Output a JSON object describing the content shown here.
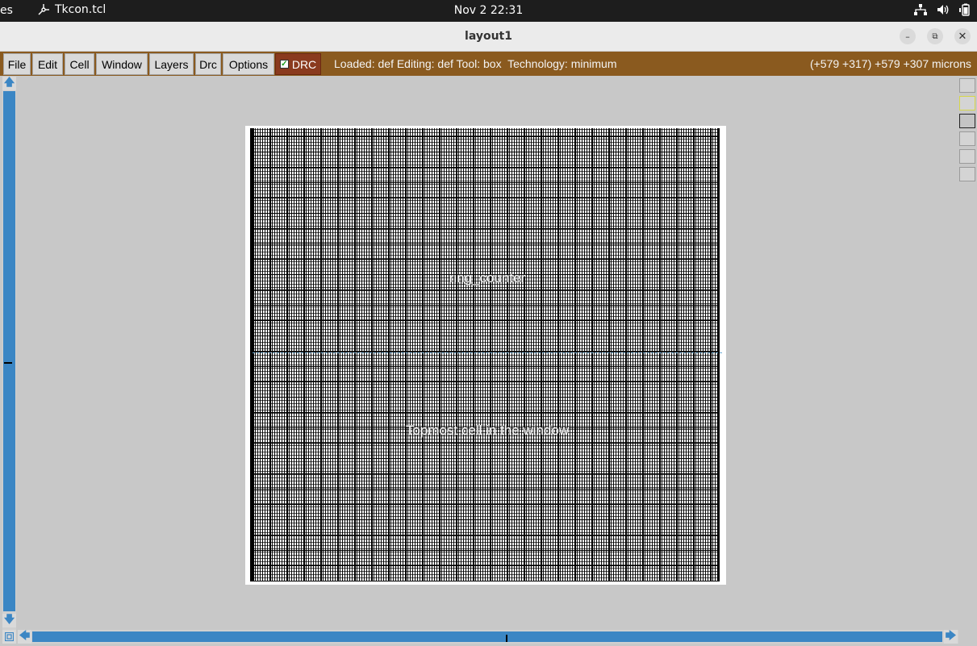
{
  "topbar": {
    "activities_label": "es",
    "app_name": "Tkcon.tcl",
    "clock": "Nov 2  22:31",
    "systray_icons": [
      "network-icon",
      "volume-icon",
      "battery-icon"
    ]
  },
  "window": {
    "title": "layout1",
    "minimize_icon": "minimize-icon",
    "maximize_icon": "restore-icon",
    "close_icon": "close-icon"
  },
  "menubar": {
    "items": [
      "File",
      "Edit",
      "Cell",
      "Window",
      "Layers",
      "Drc",
      "Options"
    ],
    "drc_toggle_label": "DRC",
    "drc_checked": true,
    "status": "Loaded: def Editing: def Tool: box  Technology: minimum",
    "coordinates": "(+579 +317) +579 +307 microns",
    "bar_color": "#8a5a1f"
  },
  "canvas": {
    "cell_name_label": "ring_counter",
    "cell_description_label": "Topmost cell in the window"
  },
  "scrollbars": {
    "accent_color": "#3b86c4"
  },
  "palette": {
    "swatches": [
      "layer-swatch-1",
      "layer-swatch-2",
      "layer-swatch-3",
      "layer-swatch-4",
      "layer-swatch-5",
      "layer-swatch-6"
    ]
  }
}
